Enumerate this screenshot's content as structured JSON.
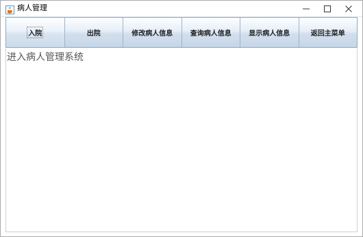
{
  "window": {
    "title": "病人管理",
    "icon": "java-cup-icon",
    "controls": {
      "minimize": "minimize-icon",
      "maximize": "maximize-icon",
      "close": "close-icon"
    }
  },
  "toolbar": {
    "buttons": [
      {
        "label": "入院",
        "active": true
      },
      {
        "label": "出院"
      },
      {
        "label": "修改病人信息"
      },
      {
        "label": "查询病人信息"
      },
      {
        "label": "显示病人信息"
      },
      {
        "label": "返回主菜单"
      }
    ]
  },
  "main": {
    "message": "进入病人管理系统"
  },
  "colors": {
    "button_gradient_top": "#fdfeff",
    "button_gradient_bottom": "#c6d6e8",
    "toolbar_border": "#8fa7c0"
  }
}
